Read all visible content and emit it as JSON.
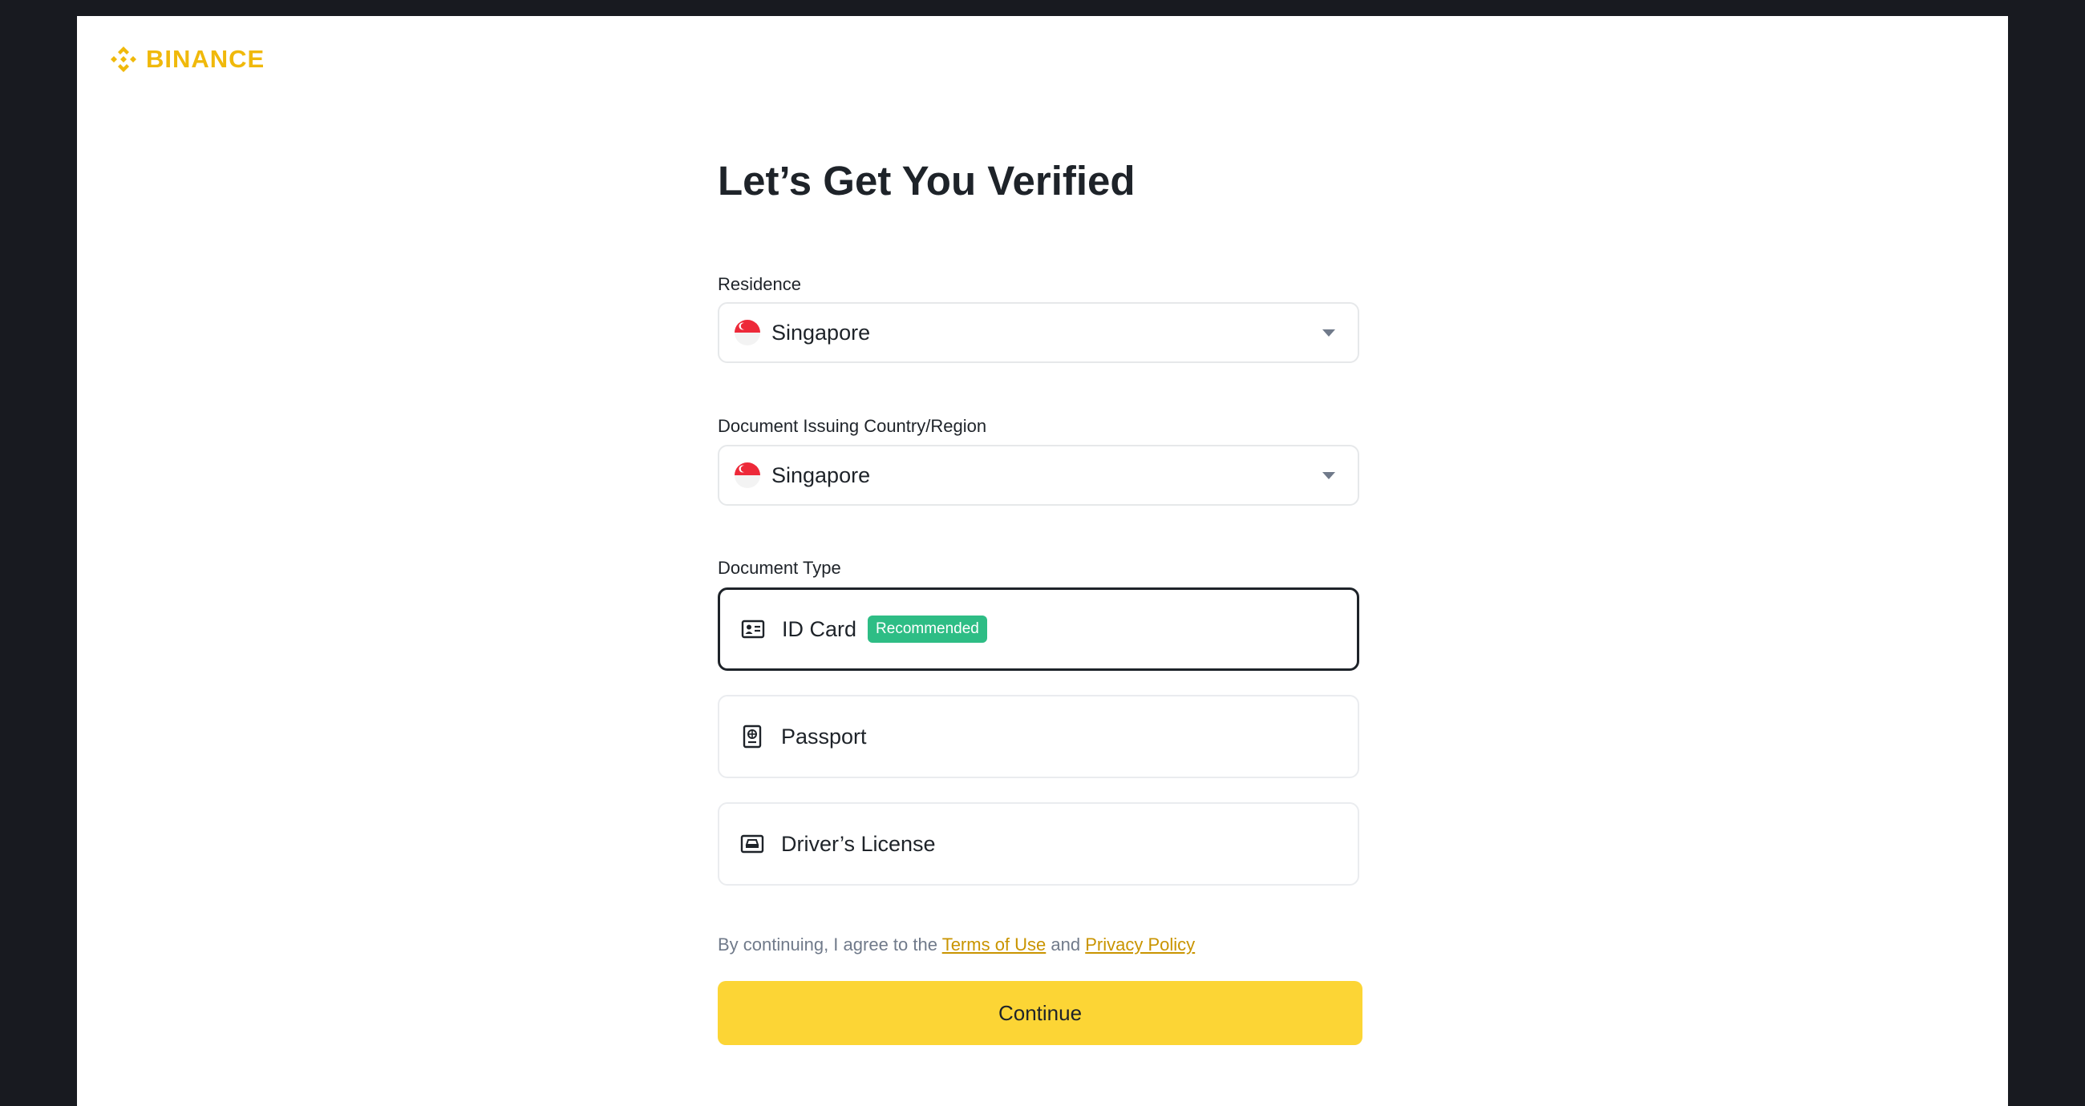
{
  "brand": {
    "name": "BINANCE",
    "color": "#f0b90b",
    "logo_icon": "binance-diamond-icon"
  },
  "title": "Let’s Get You Verified",
  "residence": {
    "label": "Residence",
    "value": "Singapore",
    "flag": "singapore-flag-icon"
  },
  "issuing_country": {
    "label": "Document Issuing Country/Region",
    "value": "Singapore",
    "flag": "singapore-flag-icon"
  },
  "document_type": {
    "label": "Document Type",
    "options": [
      {
        "label": "ID Card",
        "icon": "id-card-icon",
        "badge": "Recommended",
        "selected": true
      },
      {
        "label": "Passport",
        "icon": "passport-icon",
        "selected": false
      },
      {
        "label": "Driver’s License",
        "icon": "drivers-license-icon",
        "selected": false
      }
    ]
  },
  "agreement": {
    "prefix": "By continuing, I agree to the",
    "terms_link": "Terms of Use",
    "and": "and",
    "privacy_link": "Privacy Policy",
    "link_color": "#c99400"
  },
  "continue_label": "Continue",
  "colors": {
    "accent": "#fcd535",
    "badge": "#2ebd85",
    "background": "#181a20"
  }
}
